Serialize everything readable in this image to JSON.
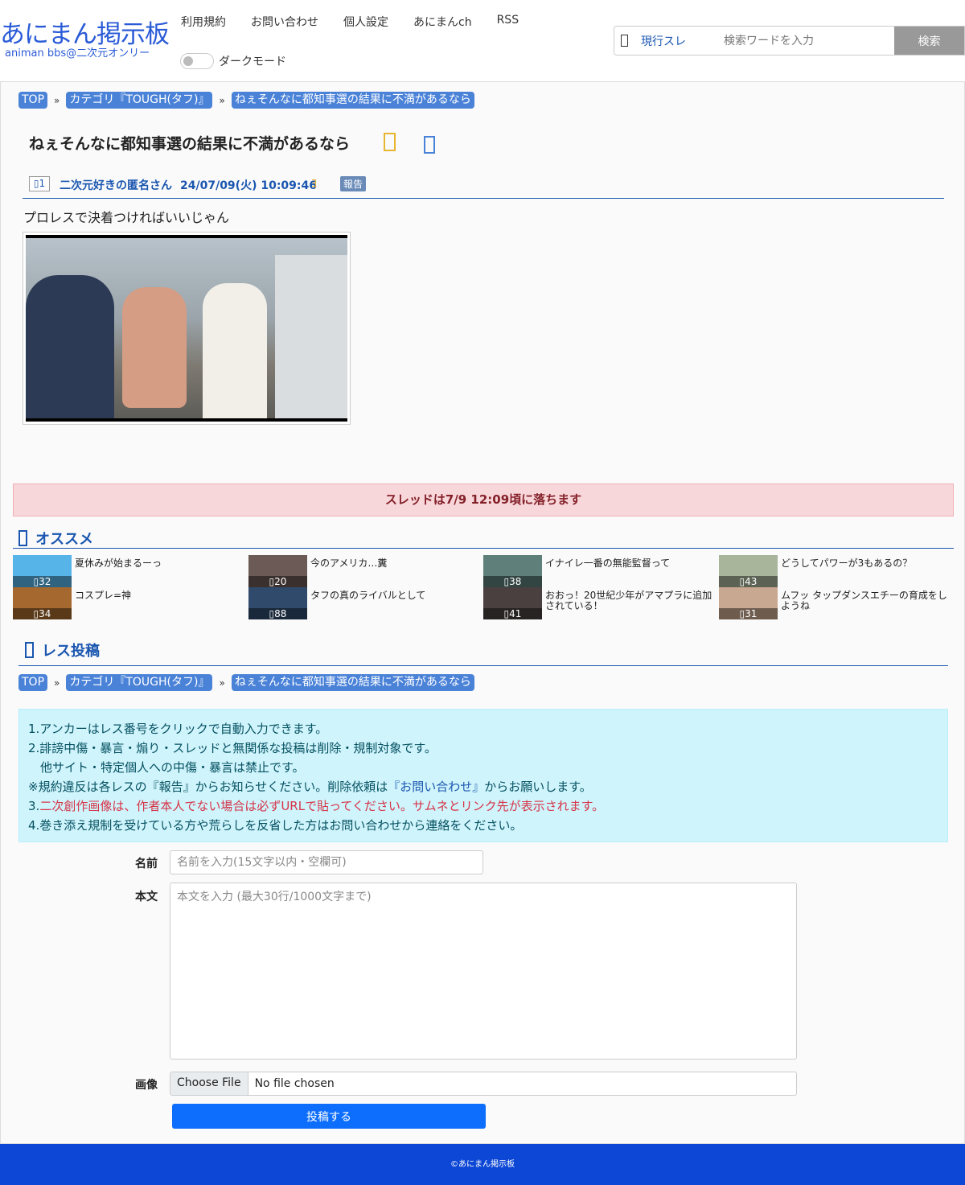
{
  "header": {
    "logo_main": "あにまん掲示板",
    "logo_sub": "animan bbs@二次元オンリー",
    "nav": [
      "利用規約",
      "お問い合わせ",
      "個人設定",
      "あにまんch",
      "RSS"
    ],
    "dark_mode_label": "ダークモード",
    "search_scope": "現行スレ",
    "search_placeholder": "検索ワードを入力",
    "search_button": "検索"
  },
  "breadcrumb": [
    "TOP",
    "カテゴリ『TOUGH(タフ)』",
    "ねぇそんなに都知事選の結果に不満があるなら"
  ],
  "breadcrumb_sep": "»",
  "thread": {
    "title": "ねぇそんなに都知事選の結果に不満があるなら",
    "post": {
      "number": "1",
      "name": "二次元好きの匿名さん",
      "date": "24/07/09(火) 10:09:46",
      "id_mark": "ﾖ",
      "report": "報告",
      "body": "プロレスで決着つければいいじゃん"
    },
    "notice": "スレッドは7/9 12:09頃に落ちます"
  },
  "recommend": {
    "title": "オススメ",
    "items": [
      {
        "title": "夏休みが始まるーっ",
        "count": "32",
        "color": "#56b4e9"
      },
      {
        "title": "今のアメリカ…糞",
        "count": "20",
        "color": "#6b5a55"
      },
      {
        "title": "イナイレ一番の無能監督って",
        "count": "38",
        "color": "#5e7f7a"
      },
      {
        "title": "どうしてパワーが3もあるの？",
        "count": "43",
        "color": "#a9b59a"
      },
      {
        "title": "コスプレ=神",
        "count": "34",
        "color": "#a5682e"
      },
      {
        "title": "タフの真のライバルとして",
        "count": "88",
        "color": "#2f4a6b"
      },
      {
        "title": "おおっ！20世紀少年がアマプラに追加されている！",
        "count": "41",
        "color": "#4a4040"
      },
      {
        "title": "ムフッ タップダンスエチーの育成をしようね",
        "count": "31",
        "color": "#c8a890"
      }
    ]
  },
  "reply": {
    "title": "レス投稿",
    "rules": [
      {
        "text": "1.アンカーはレス番号をクリックで自動入力できます。"
      },
      {
        "text": "2.誹謗中傷・暴言・煽り・スレッドと無関係な投稿は削除・規制対象です。"
      },
      {
        "text": "　他サイト・特定個人への中傷・暴言は禁止です。"
      },
      {
        "pre": "※規約違反は各レスの『報告』からお知らせください。削除依頼は",
        "link": "『お問い合わせ』",
        "post": "からお願いします。"
      },
      {
        "pre": "3.",
        "red": "二次創作画像は、作者本人でない場合は必ずURLで貼ってください。サムネとリンク先が表示されます。"
      },
      {
        "text": "4.巻き添え規制を受けている方や荒らしを反省した方はお問い合わせから連絡をください。"
      }
    ],
    "name_label": "名前",
    "name_placeholder": "名前を入力(15文字以内・空欄可)",
    "body_label": "本文",
    "body_placeholder": "本文を入力 (最大30行/1000文字まで)",
    "image_label": "画像",
    "file_button": "Choose File",
    "file_status": "No file chosen",
    "submit": "投稿する"
  },
  "footer": "©あにまん掲示板",
  "colors": {
    "accent": "#1a56b0",
    "footer": "#0d47d6",
    "notice_bg": "#f8d7da",
    "info_bg": "#cff4fc"
  }
}
